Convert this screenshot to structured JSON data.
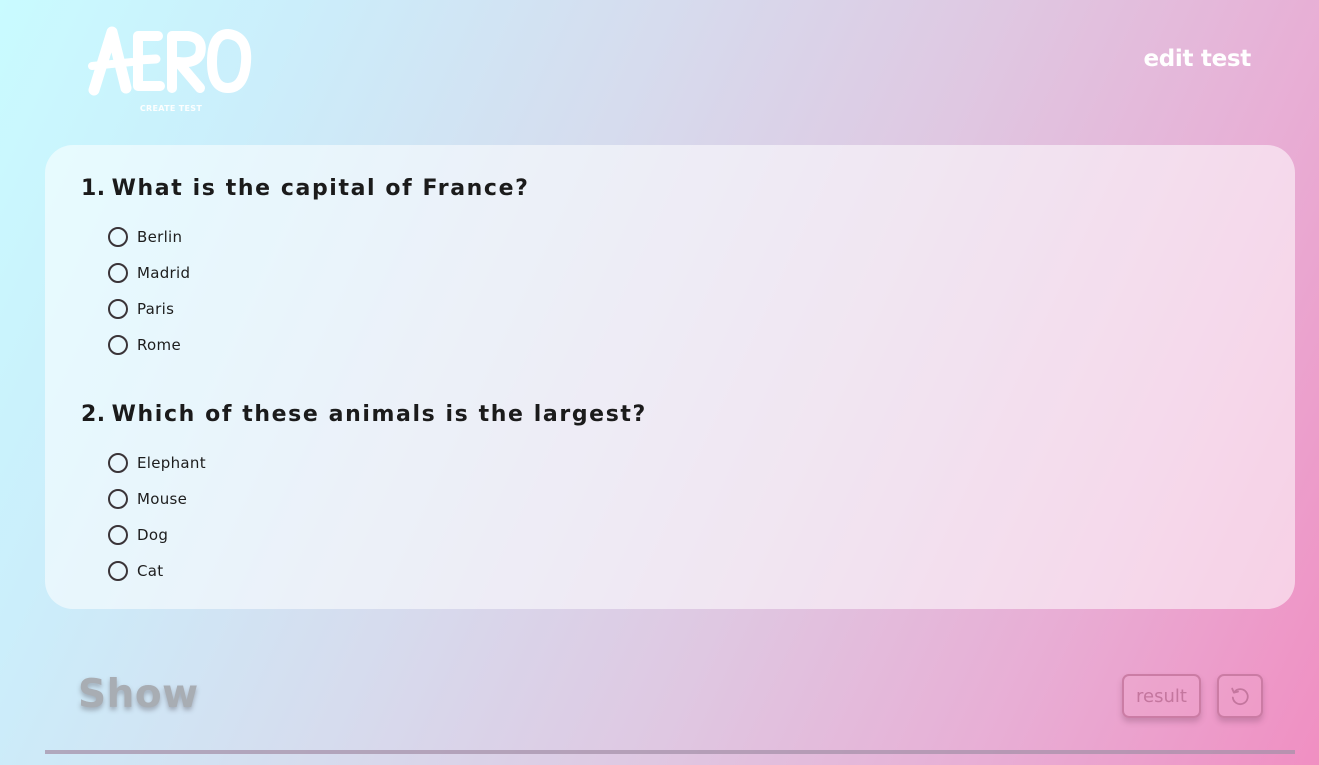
{
  "header": {
    "logo_text": "AERO",
    "logo_subtitle": "CREATE TEST",
    "edit_link": "edit test"
  },
  "quiz": {
    "questions": [
      {
        "number": "1.",
        "text": "What is the capital of France?",
        "options": [
          "Berlin",
          "Madrid",
          "Paris",
          "Rome"
        ]
      },
      {
        "number": "2.",
        "text": "Which of these animals is the largest?",
        "options": [
          "Elephant",
          "Mouse",
          "Dog",
          "Cat"
        ]
      }
    ]
  },
  "footer": {
    "show_label": "Show",
    "result_button": "result",
    "reset_icon": "refresh-icon"
  },
  "colors": {
    "accent": "#c4769e",
    "text": "#1b1b1b",
    "gradient_start": "#c9fbff",
    "gradient_end": "#f08fc2"
  }
}
